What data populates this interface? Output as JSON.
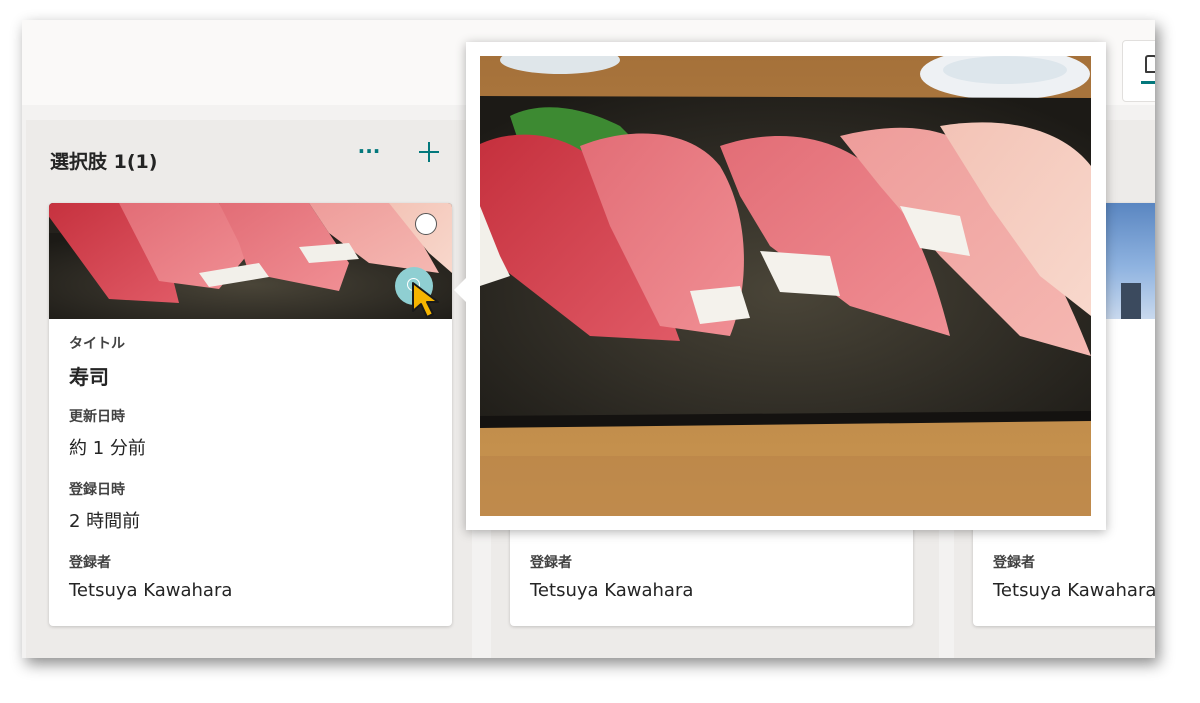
{
  "column1": {
    "title": "選択肢 1(1)",
    "more_label": "···",
    "card": {
      "title_label": "タイトル",
      "title_value": "寿司",
      "modified_label": "更新日時",
      "modified_value": "約 1 分前",
      "created_label": "登録日時",
      "created_value": "2 時間前",
      "author_label": "登録者",
      "author_value": "Tetsuya Kawahara"
    }
  },
  "column2": {
    "card": {
      "author_label": "登録者",
      "author_value": "Tetsuya Kawahara"
    }
  },
  "column3": {
    "card": {
      "author_label": "登録者",
      "author_value": "Tetsuya Kawahara"
    }
  },
  "colors": {
    "accent": "#03787c",
    "zoom_button": "#8fcfd2",
    "cursor": "#f5b400"
  },
  "icons": [
    "more-icon",
    "plus-icon",
    "select-circle-icon",
    "zoom-in-icon",
    "cursor-icon",
    "card-view-icon"
  ]
}
